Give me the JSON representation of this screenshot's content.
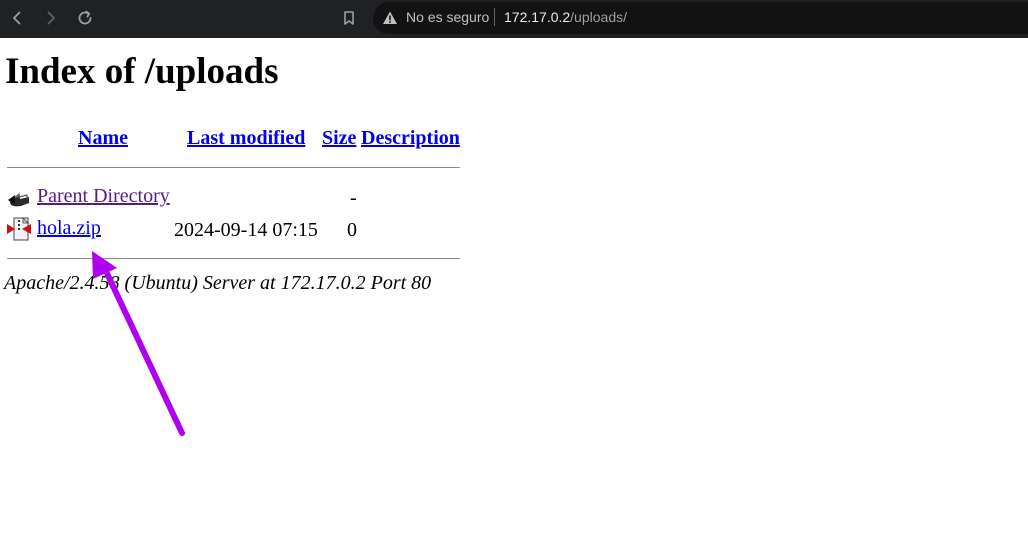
{
  "browser": {
    "security_label": "No es seguro",
    "url_host": "172.17.0.2",
    "url_path": "/uploads/"
  },
  "page": {
    "heading": "Index of /uploads",
    "columns": {
      "name": "Name",
      "last_modified": "Last modified",
      "size": "Size",
      "description": "Description"
    },
    "rows": [
      {
        "name": "Parent Directory",
        "last_modified": "",
        "size": "-",
        "description": "",
        "icon": "back-icon"
      },
      {
        "name": "hola.zip",
        "last_modified": "2024-09-14 07:15",
        "size": "0",
        "description": "",
        "icon": "compressed-file-icon"
      }
    ],
    "footer": "Apache/2.4.58 (Ubuntu) Server at 172.17.0.2 Port 80"
  },
  "colors": {
    "link": "#0000ee",
    "visited_link": "#551a8b",
    "chrome_bg": "#202124",
    "annotation_arrow": "#b000f0"
  }
}
